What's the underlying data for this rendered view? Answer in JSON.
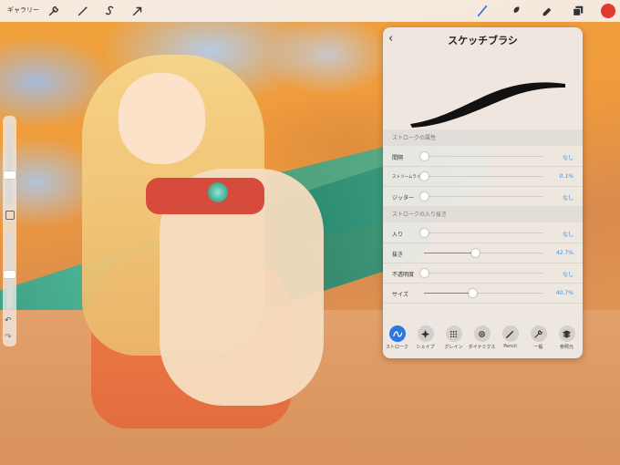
{
  "topbar": {
    "gallery_label": "ギャラリー",
    "left_tools": [
      "wrench-icon",
      "magic-wand-icon",
      "selection-s-icon",
      "arrow-icon"
    ],
    "right_tools": [
      "brush-icon",
      "smudge-icon",
      "eraser-icon",
      "layers-icon"
    ],
    "current_color": "#e23a2e"
  },
  "sidebar": {
    "size_level": 0.35,
    "opacity_level": 0.45,
    "undo": "↶",
    "redo": "↷"
  },
  "panel": {
    "back": "‹",
    "title": "スケッチブラシ",
    "sections": [
      {
        "label": "ストロークの属性",
        "rows": [
          {
            "label": "間隔",
            "value": "なし",
            "level": 0.0,
            "small": false
          },
          {
            "label": "ストリームライン",
            "value": "0.1%",
            "level": 0.0,
            "small": true
          },
          {
            "label": "ジッター",
            "value": "なし",
            "level": 0.0,
            "small": false
          }
        ]
      },
      {
        "label": "ストロークの入り抜き",
        "rows": [
          {
            "label": "入り",
            "value": "なし",
            "level": 0.0,
            "small": false
          },
          {
            "label": "抜き",
            "value": "42.7%",
            "level": 0.427,
            "small": false
          },
          {
            "label": "不透明度",
            "value": "なし",
            "level": 0.0,
            "small": false
          },
          {
            "label": "サイズ",
            "value": "40.7%",
            "level": 0.407,
            "small": false
          }
        ]
      }
    ],
    "tabs": [
      {
        "label": "ストローク",
        "icon": "stroke-icon",
        "active": true
      },
      {
        "label": "シェイプ",
        "icon": "shape-icon",
        "active": false
      },
      {
        "label": "グレイン",
        "icon": "grain-icon",
        "active": false
      },
      {
        "label": "ダイナミクス",
        "icon": "dynamics-icon",
        "active": false
      },
      {
        "label": "Pencil",
        "icon": "pencil-icon",
        "active": false
      },
      {
        "label": "一般",
        "icon": "general-icon",
        "active": false
      },
      {
        "label": "参照元",
        "icon": "source-icon",
        "active": false
      }
    ]
  },
  "colors": {
    "accent": "#2b78e4",
    "value_blue": "#4a8fd6"
  }
}
